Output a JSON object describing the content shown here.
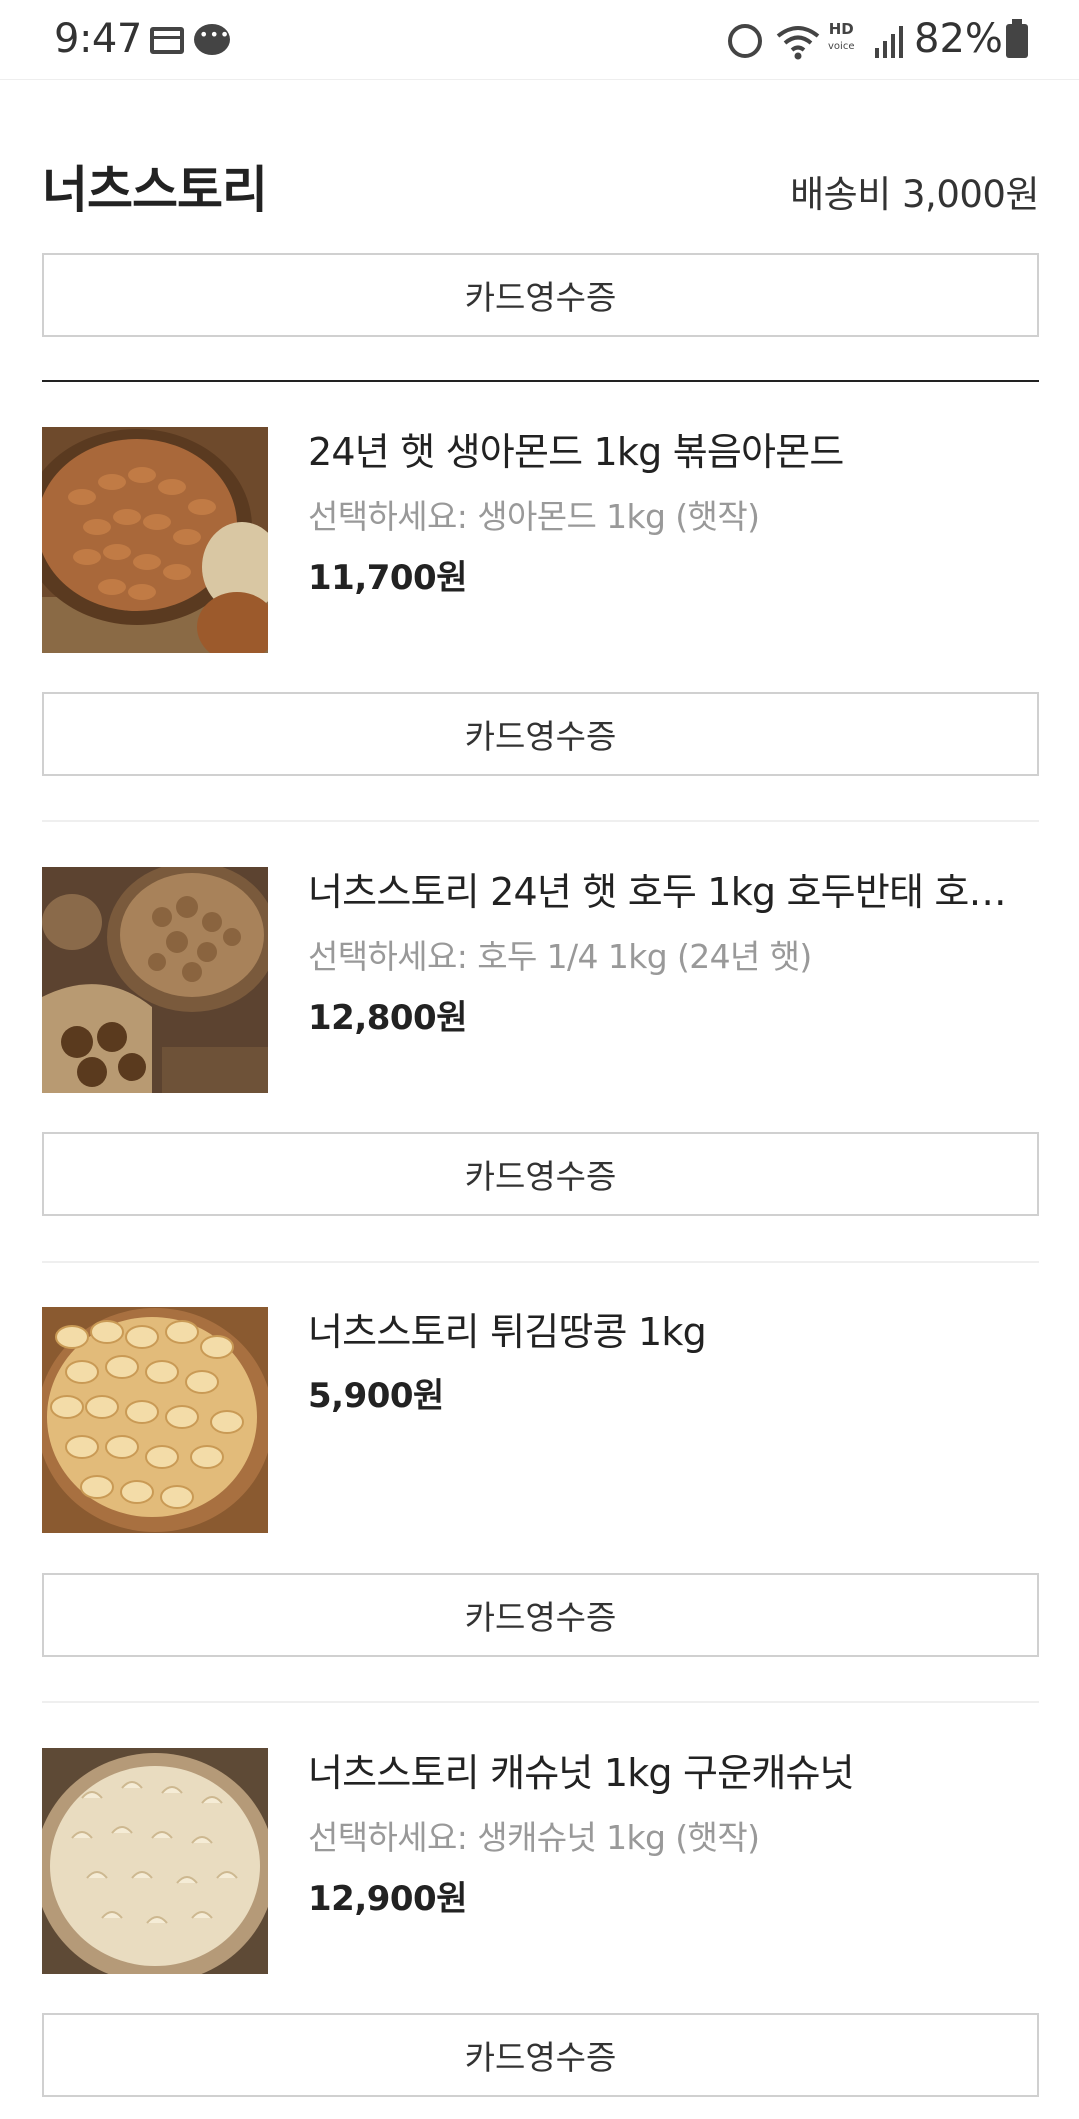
{
  "status_bar": {
    "time": "9:47",
    "battery": "82%",
    "hd_line1": "HD",
    "hd_line2": "voice"
  },
  "store": {
    "name": "너츠스토리",
    "shipping_fee": "배송비 3,000원",
    "receipt_label": "카드영수증"
  },
  "products": [
    {
      "name": "24년 햇 생아몬드 1kg 볶음아몬드",
      "option": "선택하세요: 생아몬드 1kg (햇작)",
      "price": "11,700원",
      "receipt_label": "카드영수증"
    },
    {
      "name": "너츠스토리 24년 햇 호두 1kg 호두반태 호두…",
      "option": "선택하세요: 호두 1/4 1kg (24년 햇)",
      "price": "12,800원",
      "receipt_label": "카드영수증"
    },
    {
      "name": "너츠스토리 튀김땅콩 1kg",
      "option": "",
      "price": "5,900원",
      "receipt_label": "카드영수증"
    },
    {
      "name": "너츠스토리 캐슈넛 1kg 구운캐슈넛",
      "option": "선택하세요: 생캐슈넛 1kg (햇작)",
      "price": "12,900원",
      "receipt_label": "카드영수증"
    }
  ],
  "icons": {
    "status": [
      "card-notification-icon",
      "message-icon",
      "alarm-icon",
      "wifi-icon",
      "hd-voice-icon",
      "signal-icon",
      "battery-icon"
    ],
    "products": [
      "almond-photo",
      "walnut-photo",
      "peanut-photo",
      "cashew-photo"
    ]
  }
}
